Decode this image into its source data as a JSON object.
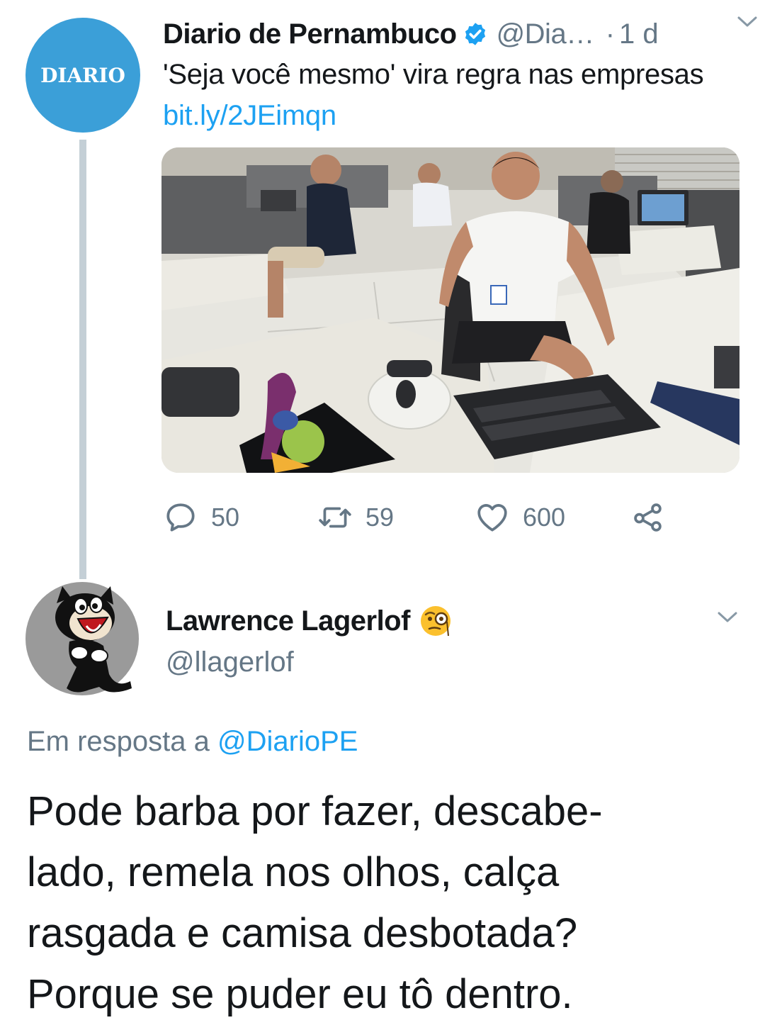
{
  "tweet": {
    "avatar_text": "DIARIO",
    "author_name": "Diario de Pernambuco",
    "author_handle": "@Dia…",
    "separator": "·",
    "time": "1 d",
    "text": "'Seja você mesmo' vira regra nas empresas ",
    "link": "bit.ly/2JEimqn",
    "image_icon": "office-photo",
    "actions": {
      "reply_count": "50",
      "retweet_count": "59",
      "like_count": "600"
    },
    "icons": [
      "verified-icon",
      "chevron-down-icon",
      "reply-icon",
      "retweet-icon",
      "like-icon",
      "share-icon"
    ]
  },
  "reply": {
    "author_name": "Lawrence Lagerlof",
    "author_emoji": "face-with-monocle",
    "author_handle": "@llagerlof",
    "reply_prefix": "Em resposta a ",
    "reply_target": "@DiarioPE",
    "text": "Pode barba por fazer, descabe-\nlado, remela nos olhos, calça\nrasgada e camisa desbotada?\nPorque se puder eu tô dentro."
  },
  "colors": {
    "accent": "#1da1f2",
    "secondary_text": "#657786",
    "diario_avatar": "#3b9fd8",
    "thread_line": "#c4cfd6"
  }
}
